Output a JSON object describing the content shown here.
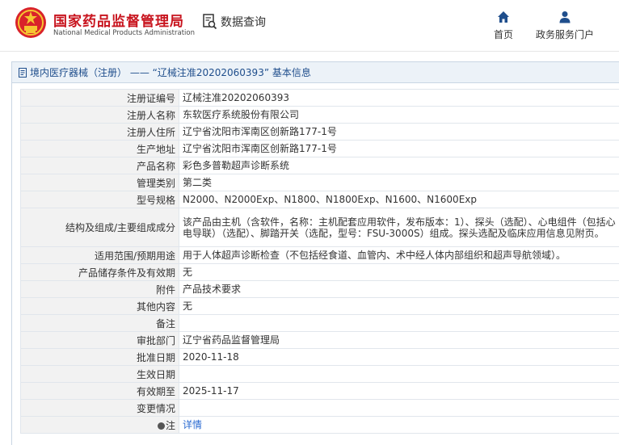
{
  "header": {
    "brand_cn": "国家药品监督管理局",
    "brand_en": "National Medical Products Administration",
    "query_label": "数据查询",
    "nav": [
      {
        "label": "首页",
        "icon": "home-icon"
      },
      {
        "label": "政务服务门户",
        "icon": "user-icon"
      }
    ],
    "brand_color": "#c8141e",
    "accent_color": "#1f4e8c"
  },
  "panel": {
    "title": "境内医疗器械（注册） —— “辽械注准20202060393” 基本信息"
  },
  "rows": [
    {
      "key": "注册证编号",
      "value": "辽械注准20202060393"
    },
    {
      "key": "注册人名称",
      "value": "东软医疗系统股份有限公司"
    },
    {
      "key": "注册人住所",
      "value": "辽宁省沈阳市浑南区创新路177-1号"
    },
    {
      "key": "生产地址",
      "value": "辽宁省沈阳市浑南区创新路177-1号"
    },
    {
      "key": "产品名称",
      "value": "彩色多普勒超声诊断系统"
    },
    {
      "key": "管理类别",
      "value": "第二类"
    },
    {
      "key": "型号规格",
      "value": "N2000、N2000Exp、N1800、N1800Exp、N1600、N1600Exp"
    },
    {
      "key": "结构及组成/主要组成成分",
      "value": "该产品由主机（含软件，名称：主机配套应用软件，发布版本：1）、探头（选配）、心电组件（包括心电导联）（选配）、脚踏开关（选配，型号：FSU-3000S）组成。探头选配及临床应用信息见附页。"
    },
    {
      "key": "适用范围/预期用途",
      "value": "用于人体超声诊断检查（不包括经食道、血管内、术中经人体内部组织和超声导航领域）。"
    },
    {
      "key": "产品储存条件及有效期",
      "value": "无"
    },
    {
      "key": "附件",
      "value": "产品技术要求"
    },
    {
      "key": "其他内容",
      "value": "无"
    },
    {
      "key": "备注",
      "value": ""
    },
    {
      "key": "审批部门",
      "value": "辽宁省药品监督管理局"
    },
    {
      "key": "批准日期",
      "value": "2020-11-18"
    },
    {
      "key": "生效日期",
      "value": ""
    },
    {
      "key": "有效期至",
      "value": "2025-11-17"
    },
    {
      "key": "变更情况",
      "value": ""
    }
  ],
  "note_row": {
    "key": "注",
    "link": "详情"
  }
}
